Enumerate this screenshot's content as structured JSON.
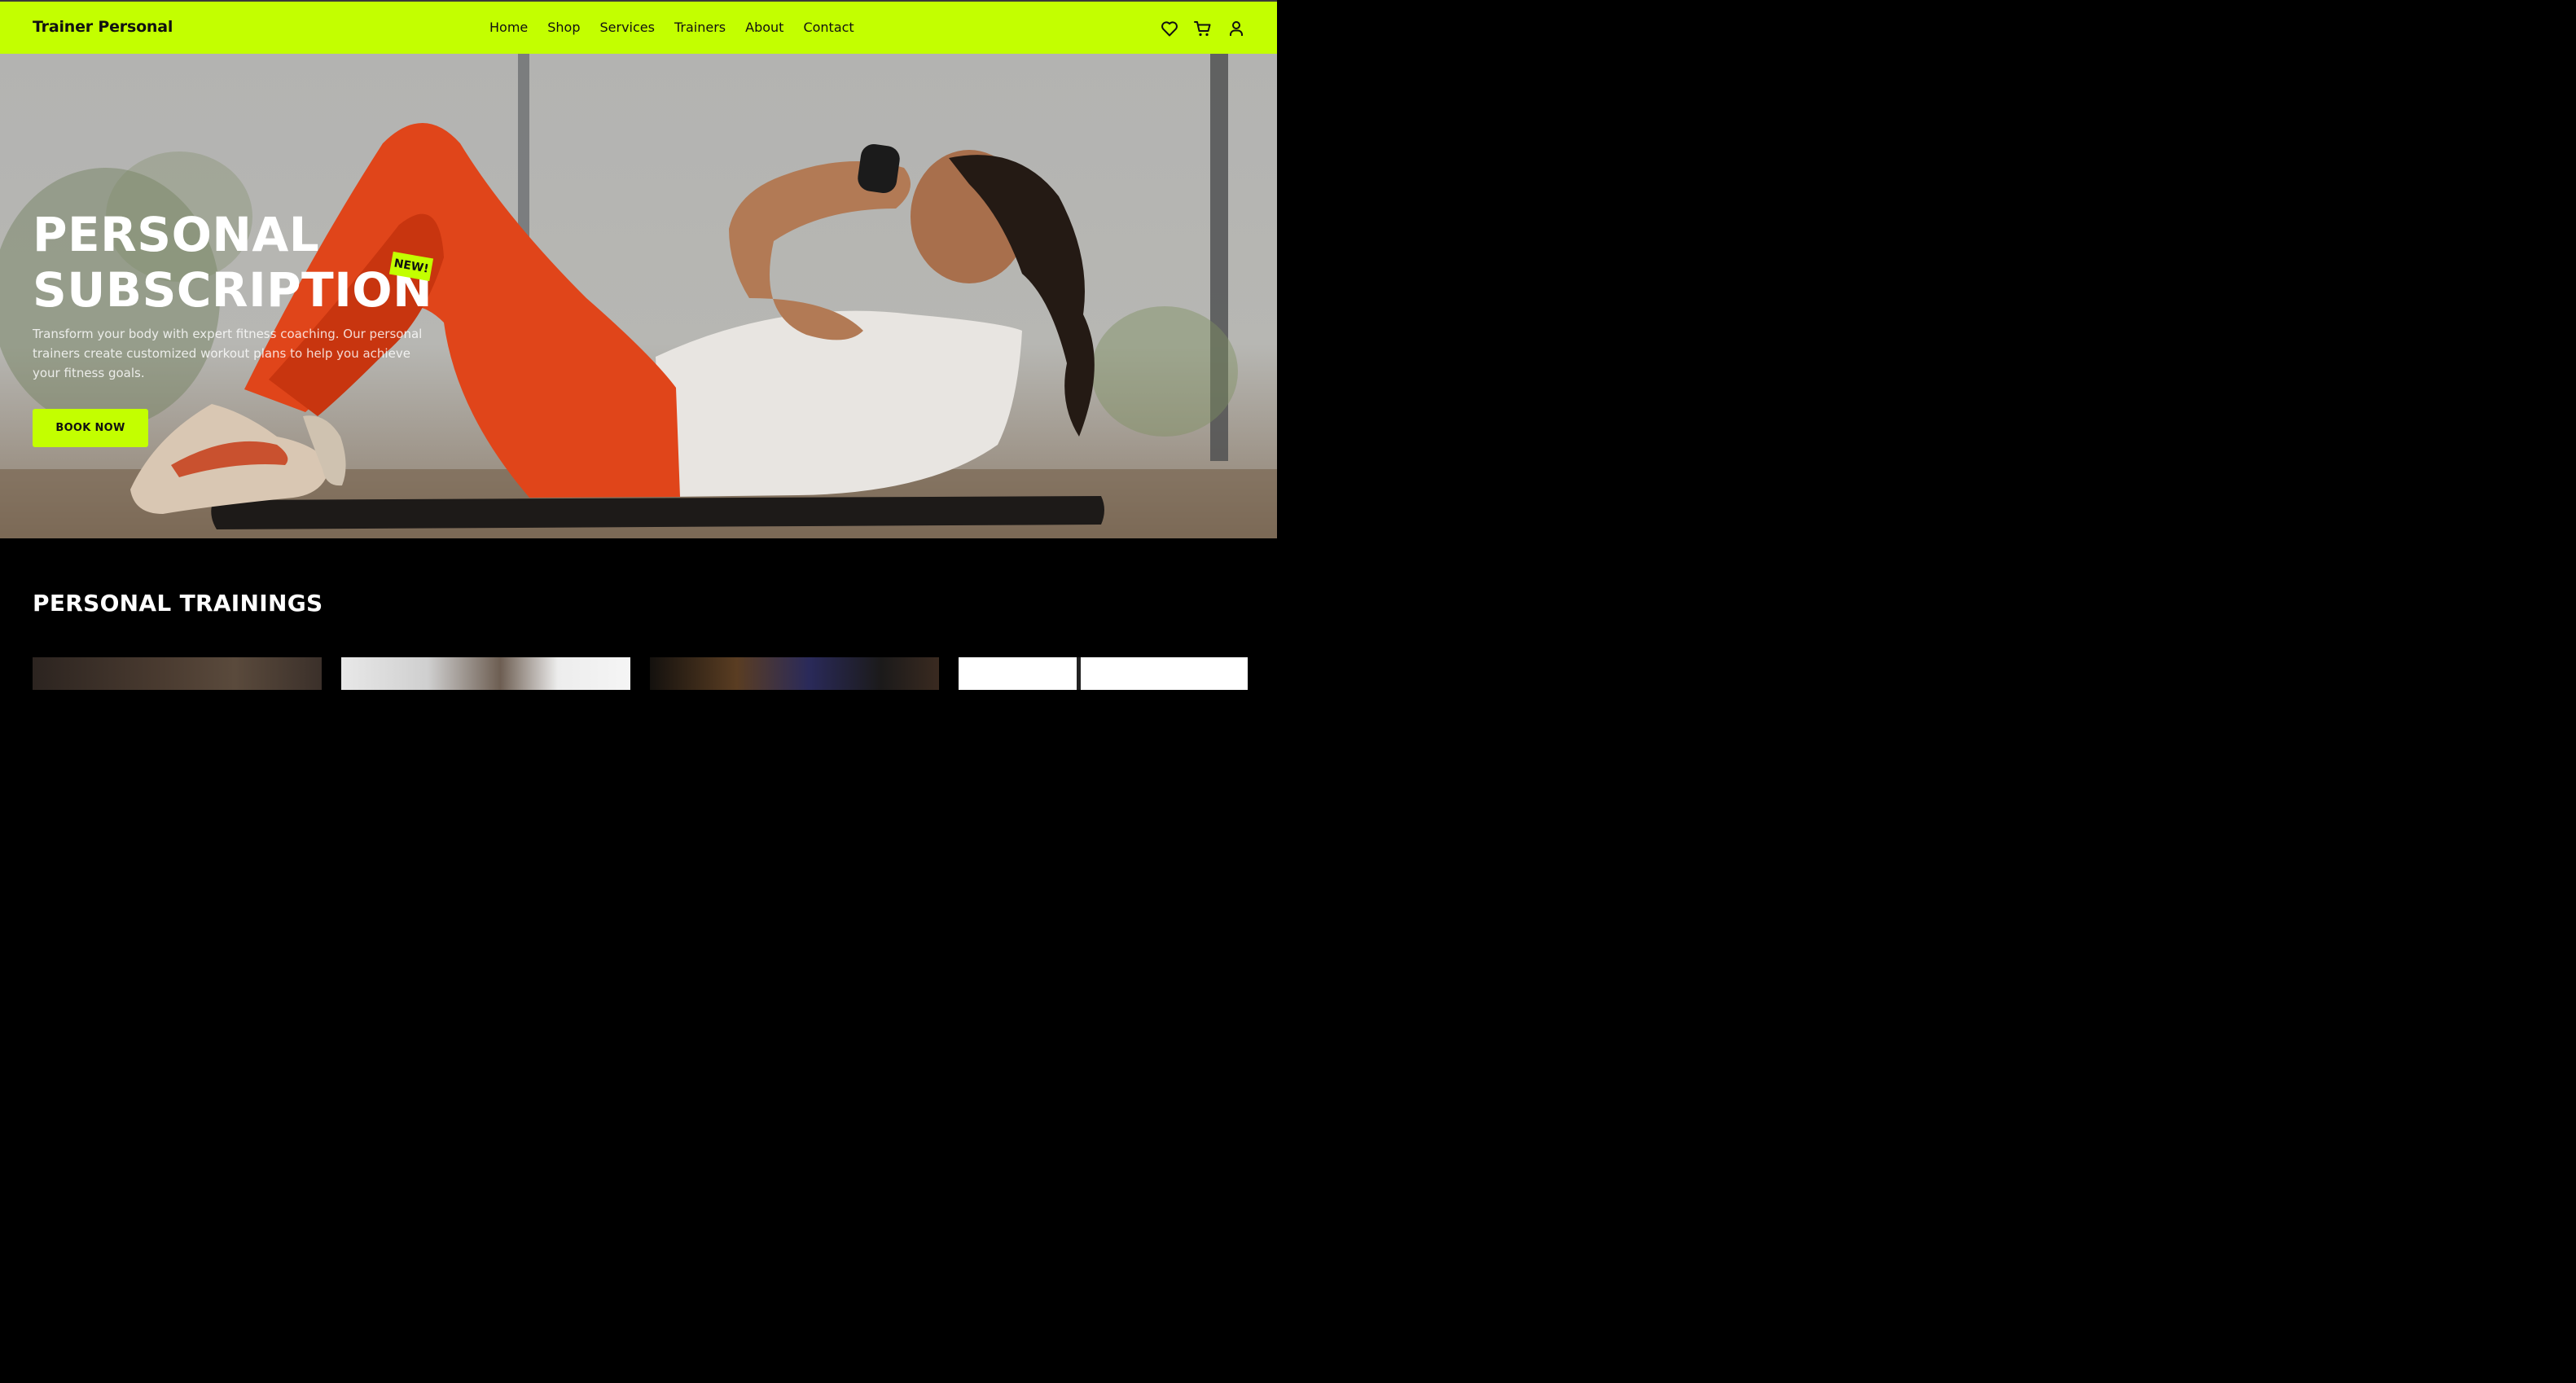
{
  "header": {
    "brand": "Trainer Personal",
    "nav": [
      "Home",
      "Shop",
      "Services",
      "Trainers",
      "About",
      "Contact"
    ],
    "icons": [
      "heart-icon",
      "cart-icon",
      "user-icon"
    ],
    "accent_color": "#c3ff00"
  },
  "hero": {
    "title_line1": "PERSONAL",
    "title_line2": "SUBSCRIPTION",
    "badge": "NEW!",
    "description": "Transform your body with expert fitness coaching. Our personal trainers create customized workout plans to help you achieve your fitness goals.",
    "cta": "BOOK NOW"
  },
  "trainings": {
    "title": "PERSONAL TRAININGS"
  }
}
